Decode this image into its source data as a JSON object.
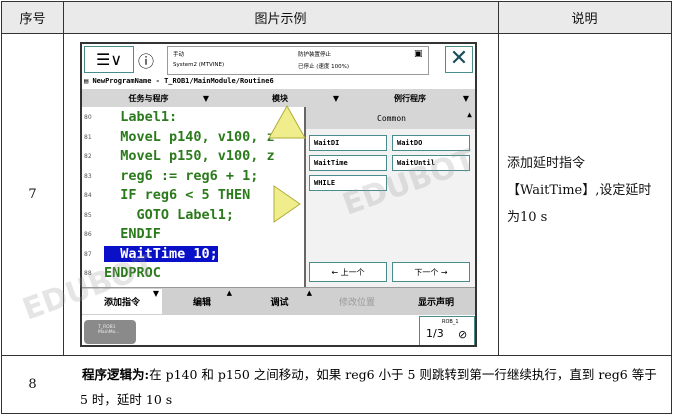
{
  "table": {
    "headers": [
      "序号",
      "图片示例",
      "说明"
    ],
    "rows": [
      {
        "no": "7",
        "description": "添加延时指令【WaitTime】,设定延时为10 s"
      },
      {
        "no": "8",
        "label": "程序逻辑为:",
        "text": "在 p140 和 p150 之间移动，如果 reg6 小于 5 则跳转到第一行继续执行，直到 reg6 等于 5 时，延时 10 s"
      }
    ]
  },
  "pendant": {
    "status": {
      "mode": "手动",
      "system": "System2 (MTVINE)",
      "guard": "防护装置停止",
      "state": "已停止 (速度 100%)"
    },
    "path": "NewProgramName - T_ROB1/MainModule/Routine6",
    "tabs": [
      "任务与程序",
      "模块",
      "例行程序"
    ],
    "lines": [
      {
        "n": "80",
        "code": "  Label1:"
      },
      {
        "n": "81",
        "code": "  MoveL p140, v100, z"
      },
      {
        "n": "82",
        "code": "  MoveL p150, v100, z"
      },
      {
        "n": "83",
        "code": "  reg6 := reg6 + 1;"
      },
      {
        "n": "84",
        "code": "  IF reg6 < 5 THEN"
      },
      {
        "n": "85",
        "code": "    GOTO Label1;"
      },
      {
        "n": "86",
        "code": "  ENDIF"
      },
      {
        "n": "87",
        "code": "  WaitTime 10;"
      },
      {
        "n": "88",
        "code": "ENDPROC"
      }
    ],
    "panel": {
      "title": "Common",
      "items": [
        "WaitDI",
        "WaitDO",
        "WaitTime",
        "WaitUntil",
        "WHILE"
      ],
      "prev": "←  上一个",
      "next": "下一个  →"
    },
    "commands": [
      "添加指令",
      "编辑",
      "调试",
      "修改位置",
      "显示声明"
    ],
    "taskbar": {
      "task": "T_ROB1",
      "module": "MainMo...",
      "rob": "ROB_1",
      "fraction": "1/3"
    }
  },
  "watermark": "EDUBOT"
}
